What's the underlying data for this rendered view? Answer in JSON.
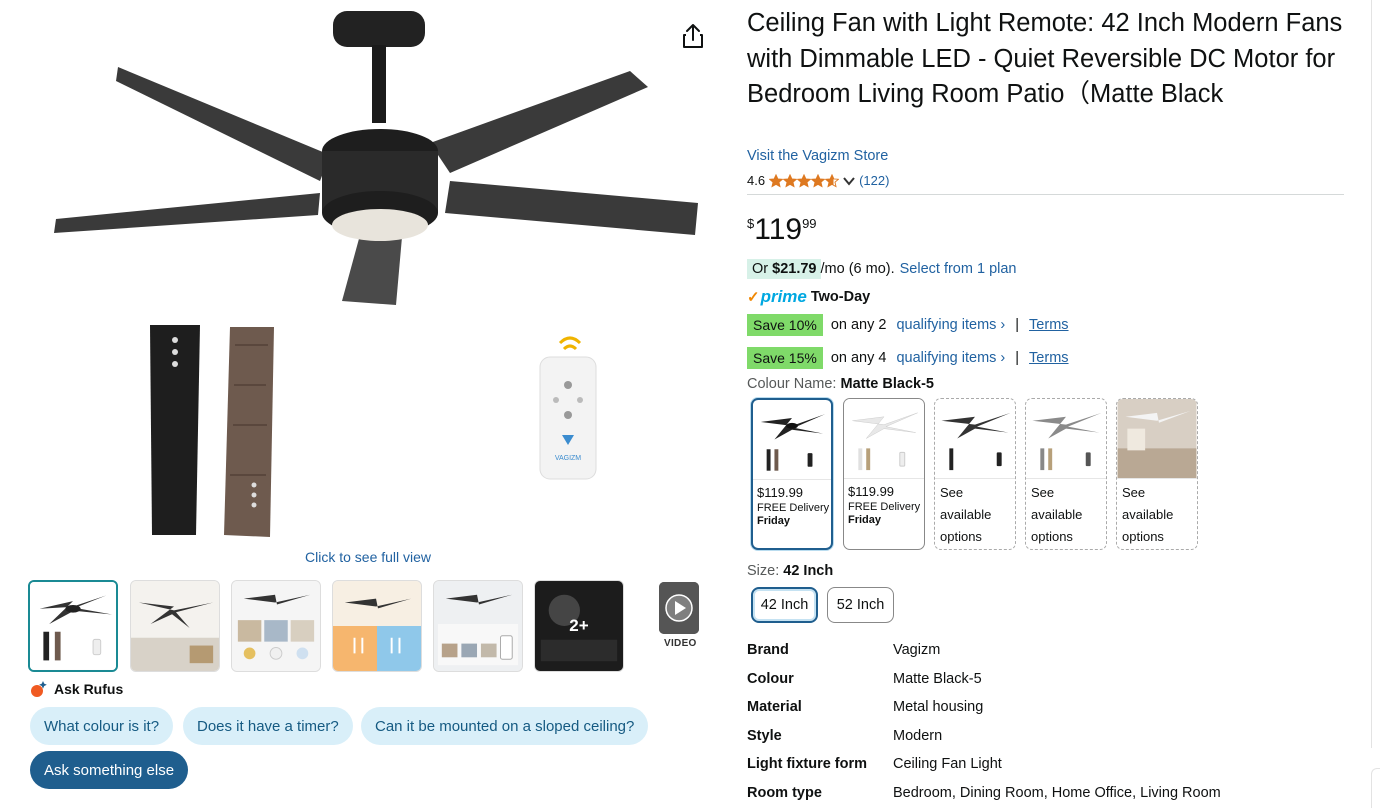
{
  "product": {
    "title": "Ceiling Fan with Light Remote: 42 Inch Modern Fans with Dimmable LED - Quiet Reversible DC Motor for Bedroom Living Room Patio（Matte Black",
    "store_link": "Visit the Vagizm Store",
    "rating_value": "4.6",
    "rating_stars": 4.6,
    "rating_count": "(122)"
  },
  "gallery": {
    "click_full_view": "Click to see full view",
    "more_label": "2+",
    "video_label": "VIDEO",
    "remote_brand": "VAGIZM"
  },
  "rufus": {
    "label": "Ask Rufus",
    "chips": [
      "What colour is it?",
      "Does it have a timer?",
      "Can it be mounted on a sloped ceiling?"
    ],
    "ask_else": "Ask something else"
  },
  "price": {
    "currency": "$",
    "whole": "119",
    "fraction": "99",
    "emi_prefix": "Or ",
    "emi_amount": "$21.79",
    "emi_suffix": "/mo (6 mo).",
    "emi_link": "Select from 1 plan"
  },
  "prime": {
    "logo": "prime",
    "delivery": "Two-Day"
  },
  "savings": [
    {
      "badge": "Save 10%",
      "text": "on any 2",
      "link": "qualifying items ›",
      "sep": "|",
      "terms": "Terms"
    },
    {
      "badge": "Save 15%",
      "text": "on any 4",
      "link": "qualifying items ›",
      "sep": "|",
      "terms": "Terms"
    }
  ],
  "colour": {
    "label": "Colour Name: ",
    "selected": "Matte Black-5",
    "swatches": [
      {
        "price": "$119.99",
        "delivery": "FREE Delivery",
        "day": "Friday"
      },
      {
        "price": "$119.99",
        "delivery": "FREE Delivery",
        "day": "Friday"
      },
      {
        "see": "See available options"
      },
      {
        "see": "See available options"
      },
      {
        "see": "See available options"
      }
    ]
  },
  "size": {
    "label": "Size: ",
    "selected": "42 Inch",
    "options": [
      "42 Inch",
      "52 Inch"
    ]
  },
  "specs": [
    {
      "key": "Brand",
      "value": "Vagizm"
    },
    {
      "key": "Colour",
      "value": "Matte Black-5"
    },
    {
      "key": "Material",
      "value": "Metal housing"
    },
    {
      "key": "Style",
      "value": "Modern"
    },
    {
      "key": "Light fixture form",
      "value": "Ceiling Fan Light"
    },
    {
      "key": "Room type",
      "value": "Bedroom, Dining Room, Home Office, Living Room"
    }
  ],
  "colors": {
    "link": "#2162a1",
    "save_badge": "#7fda69",
    "emi_highlight": "#d7f1e8",
    "prime_blue": "#00a8e1",
    "star": "#de7921",
    "chip_bg": "#d9eff9",
    "chip_dark": "#1f5e8e"
  }
}
